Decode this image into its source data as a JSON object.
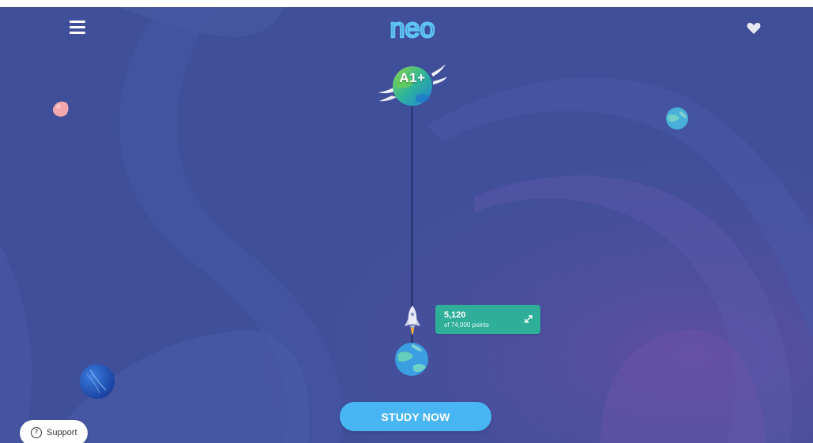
{
  "header": {
    "menu_icon": "hamburger-menu-icon",
    "logo_text": "neo",
    "favorite_icon": "heart-icon"
  },
  "journey": {
    "target_level": "A1+",
    "current_points": "5,120",
    "points_subtitle": "of 74,000 points",
    "progress_fraction": 0.069,
    "expand_icon": "expand-arrows-icon"
  },
  "actions": {
    "study_label": "STUDY NOW",
    "support_label": "Support",
    "support_icon_glyph": "?"
  },
  "colors": {
    "background": "#3f4f9a",
    "accent_blue": "#48b6f3",
    "points_card": "#2fae9a",
    "logo": "#5ec4f5"
  }
}
